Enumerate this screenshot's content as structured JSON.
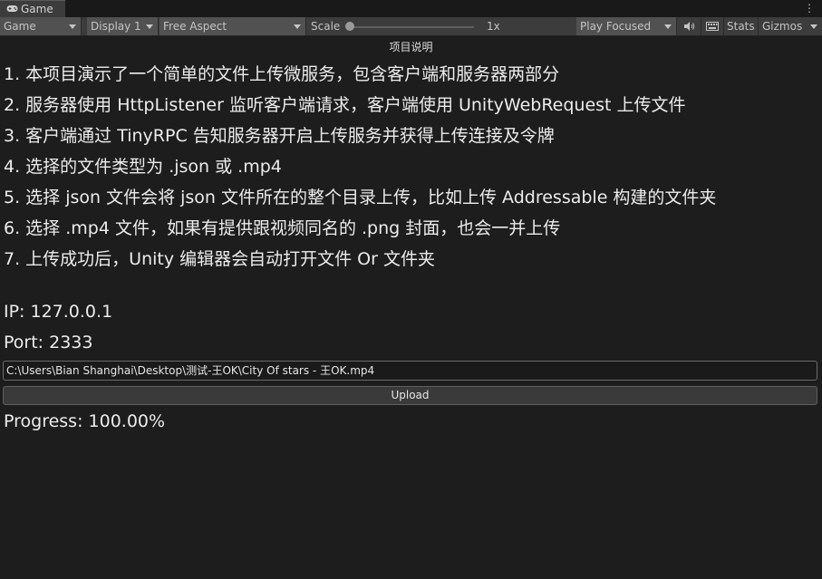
{
  "tab": {
    "title": "Game"
  },
  "toolbar": {
    "view_mode": "Game",
    "display": "Display 1",
    "aspect": "Free Aspect",
    "scale_label": "Scale",
    "scale_value": "1x",
    "scale_level": 0.0,
    "play_mode": "Play Focused",
    "stats": "Stats",
    "gizmos": "Gizmos"
  },
  "content": {
    "heading": "项目说明",
    "lines": [
      "1. 本项目演示了一个简单的文件上传微服务，包含客户端和服务器两部分",
      "2. 服务器使用 HttpListener 监听客户端请求，客户端使用 UnityWebRequest 上传文件",
      "3. 客户端通过 TinyRPC 告知服务器开启上传服务并获得上传连接及令牌",
      "4. 选择的文件类型为 .json 或 .mp4",
      "5. 选择 json 文件会将 json 文件所在的整个目录上传，比如上传 Addressable 构建的文件夹",
      "6. 选择 .mp4 文件，如果有提供跟视频同名的 .png 封面，也会一并上传",
      "7. 上传成功后，Unity 编辑器会自动打开文件 Or 文件夹"
    ],
    "ip": "IP: 127.0.0.1",
    "port": "Port: 2333",
    "file_path": "C:\\Users\\Bian Shanghai\\Desktop\\测试-王OK\\City Of stars  - 王OK.mp4",
    "upload_label": "Upload",
    "progress": "Progress: 100.00%"
  }
}
